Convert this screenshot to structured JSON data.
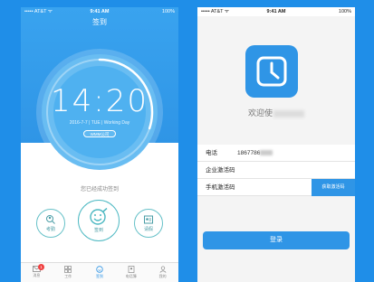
{
  "left": {
    "status": {
      "carrier": "••••• AT&T  ᯤ",
      "time": "9:41 AM",
      "battery": "100%"
    },
    "title": "签到",
    "clock": {
      "time": "14:20",
      "date": "2016-7-7  |  TUE  |  Working Day",
      "company": "WMM公司"
    },
    "message": "您已经成功签到",
    "actions": {
      "kaoqin": "考勤",
      "qiandao": "签到",
      "qingjia": "请假"
    },
    "tabs": [
      {
        "label": "消息",
        "badge": "1"
      },
      {
        "label": "工作"
      },
      {
        "label": "签到"
      },
      {
        "label": "电话簿"
      },
      {
        "label": "我的"
      }
    ],
    "progress_fraction": 0.3,
    "colors": {
      "primary": "#2f95e6",
      "accent": "#4cb8c2",
      "badge": "#f04040"
    }
  },
  "right": {
    "status": {
      "carrier": "••••• AT&T  ᯤ",
      "time": "9:41 AM",
      "battery": "100%"
    },
    "welcome": "欢迎使",
    "form": {
      "phone_label": "电话",
      "phone_value": "1867786",
      "company_code_label": "企业激活码",
      "sms_code_label": "手机激活码",
      "get_code_button": "获取激活码"
    },
    "login_button": "登录"
  }
}
